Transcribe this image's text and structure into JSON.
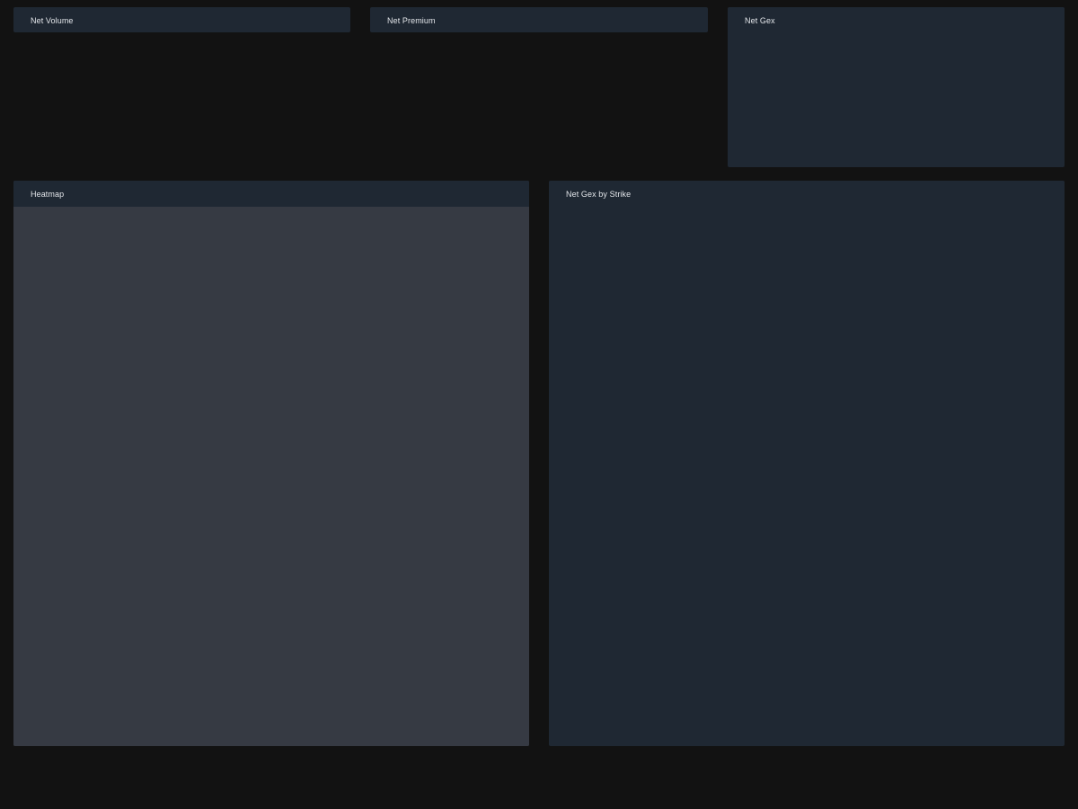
{
  "panels": {
    "net_volume": {
      "title": "Net Volume"
    },
    "net_premium": {
      "title": "Net Premium"
    },
    "net_gex": {
      "title": "Net Gex"
    },
    "heatmap": {
      "title": "Heatmap"
    },
    "net_gex_by_strike": {
      "title": "Net Gex by Strike"
    }
  },
  "colors": {
    "page_background": "#121212",
    "panel_header": "#1f2833",
    "heatmap_body": "#363a43",
    "panel_body": "#1f2833",
    "title_text": "#e3e6ea"
  }
}
